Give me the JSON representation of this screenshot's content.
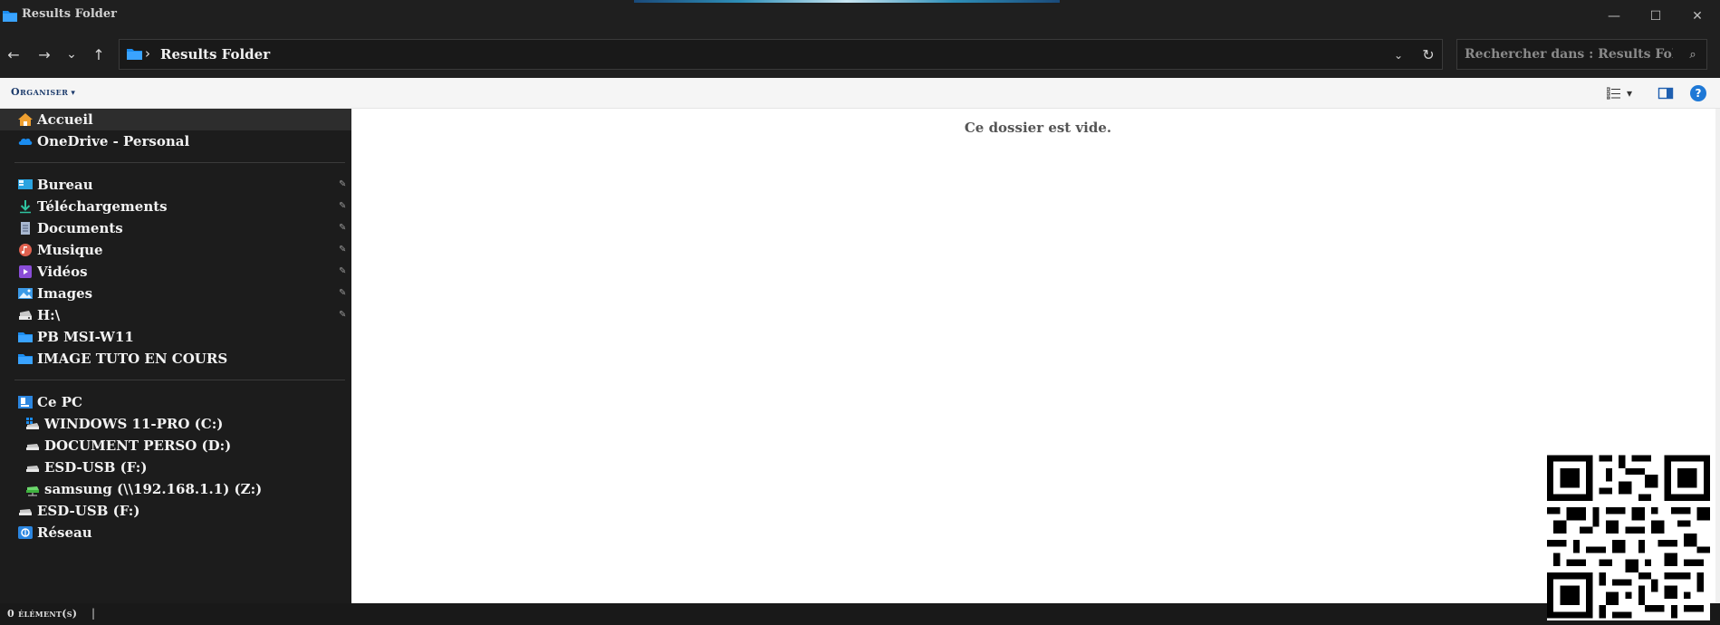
{
  "window": {
    "title": "Results Folder",
    "minimize_symbol": "—",
    "maximize_symbol": "☐",
    "close_symbol": "✕"
  },
  "toolbar": {
    "back_symbol": "←",
    "forward_symbol": "→",
    "recent_symbol": "⌄",
    "up_symbol": "↑",
    "path_separator": "›",
    "path": "Results Folder",
    "dropdown_symbol": "⌄",
    "refresh_symbol": "↻"
  },
  "search": {
    "placeholder": "Rechercher dans : Results Folder",
    "icon": "search-icon",
    "icon_symbol": "⌕"
  },
  "commandbar": {
    "organise_label": "Organiser",
    "caret_symbol": "▾",
    "view_caret_symbol": "▾",
    "help_symbol": "?"
  },
  "sidebar": {
    "pin_symbol": "✎",
    "quick": [
      {
        "label": "Accueil",
        "icon": "home-icon"
      },
      {
        "label": "OneDrive - Personal",
        "icon": "cloud-icon"
      }
    ],
    "pinned": [
      {
        "label": "Bureau",
        "icon": "desktop-icon"
      },
      {
        "label": "Téléchargements",
        "icon": "download-icon"
      },
      {
        "label": "Documents",
        "icon": "documents-icon"
      },
      {
        "label": "Musique",
        "icon": "music-icon"
      },
      {
        "label": "Vidéos",
        "icon": "videos-icon"
      },
      {
        "label": "Images",
        "icon": "pictures-icon"
      },
      {
        "label": "H:\\",
        "icon": "drive-icon"
      }
    ],
    "folders": [
      {
        "label": "PB MSI-W11",
        "icon": "folder-icon"
      },
      {
        "label": "IMAGE TUTO EN COURS",
        "icon": "folder-icon"
      }
    ],
    "pc": {
      "label": "Ce PC",
      "drives": [
        {
          "label": "WINDOWS 11-PRO (C:)",
          "icon": "system-drive-icon"
        },
        {
          "label": "DOCUMENT PERSO (D:)",
          "icon": "drive-icon"
        },
        {
          "label": "ESD-USB (F:)",
          "icon": "drive-icon"
        },
        {
          "label": "samsung (\\\\192.168.1.1) (Z:)",
          "icon": "network-drive-icon"
        }
      ]
    },
    "extra": [
      {
        "label": "ESD-USB (F:)",
        "icon": "drive-icon"
      },
      {
        "label": "Réseau",
        "icon": "network-icon"
      }
    ]
  },
  "content": {
    "empty_message": "Ce dossier est vide."
  },
  "status": {
    "item_count": "0 élément(s)",
    "separator": "|"
  },
  "colors": {
    "accent": "#1e78d6",
    "folder": "#1a8cf0",
    "nav_bg": "#1c1c1c",
    "content_bg": "#ffffff"
  }
}
